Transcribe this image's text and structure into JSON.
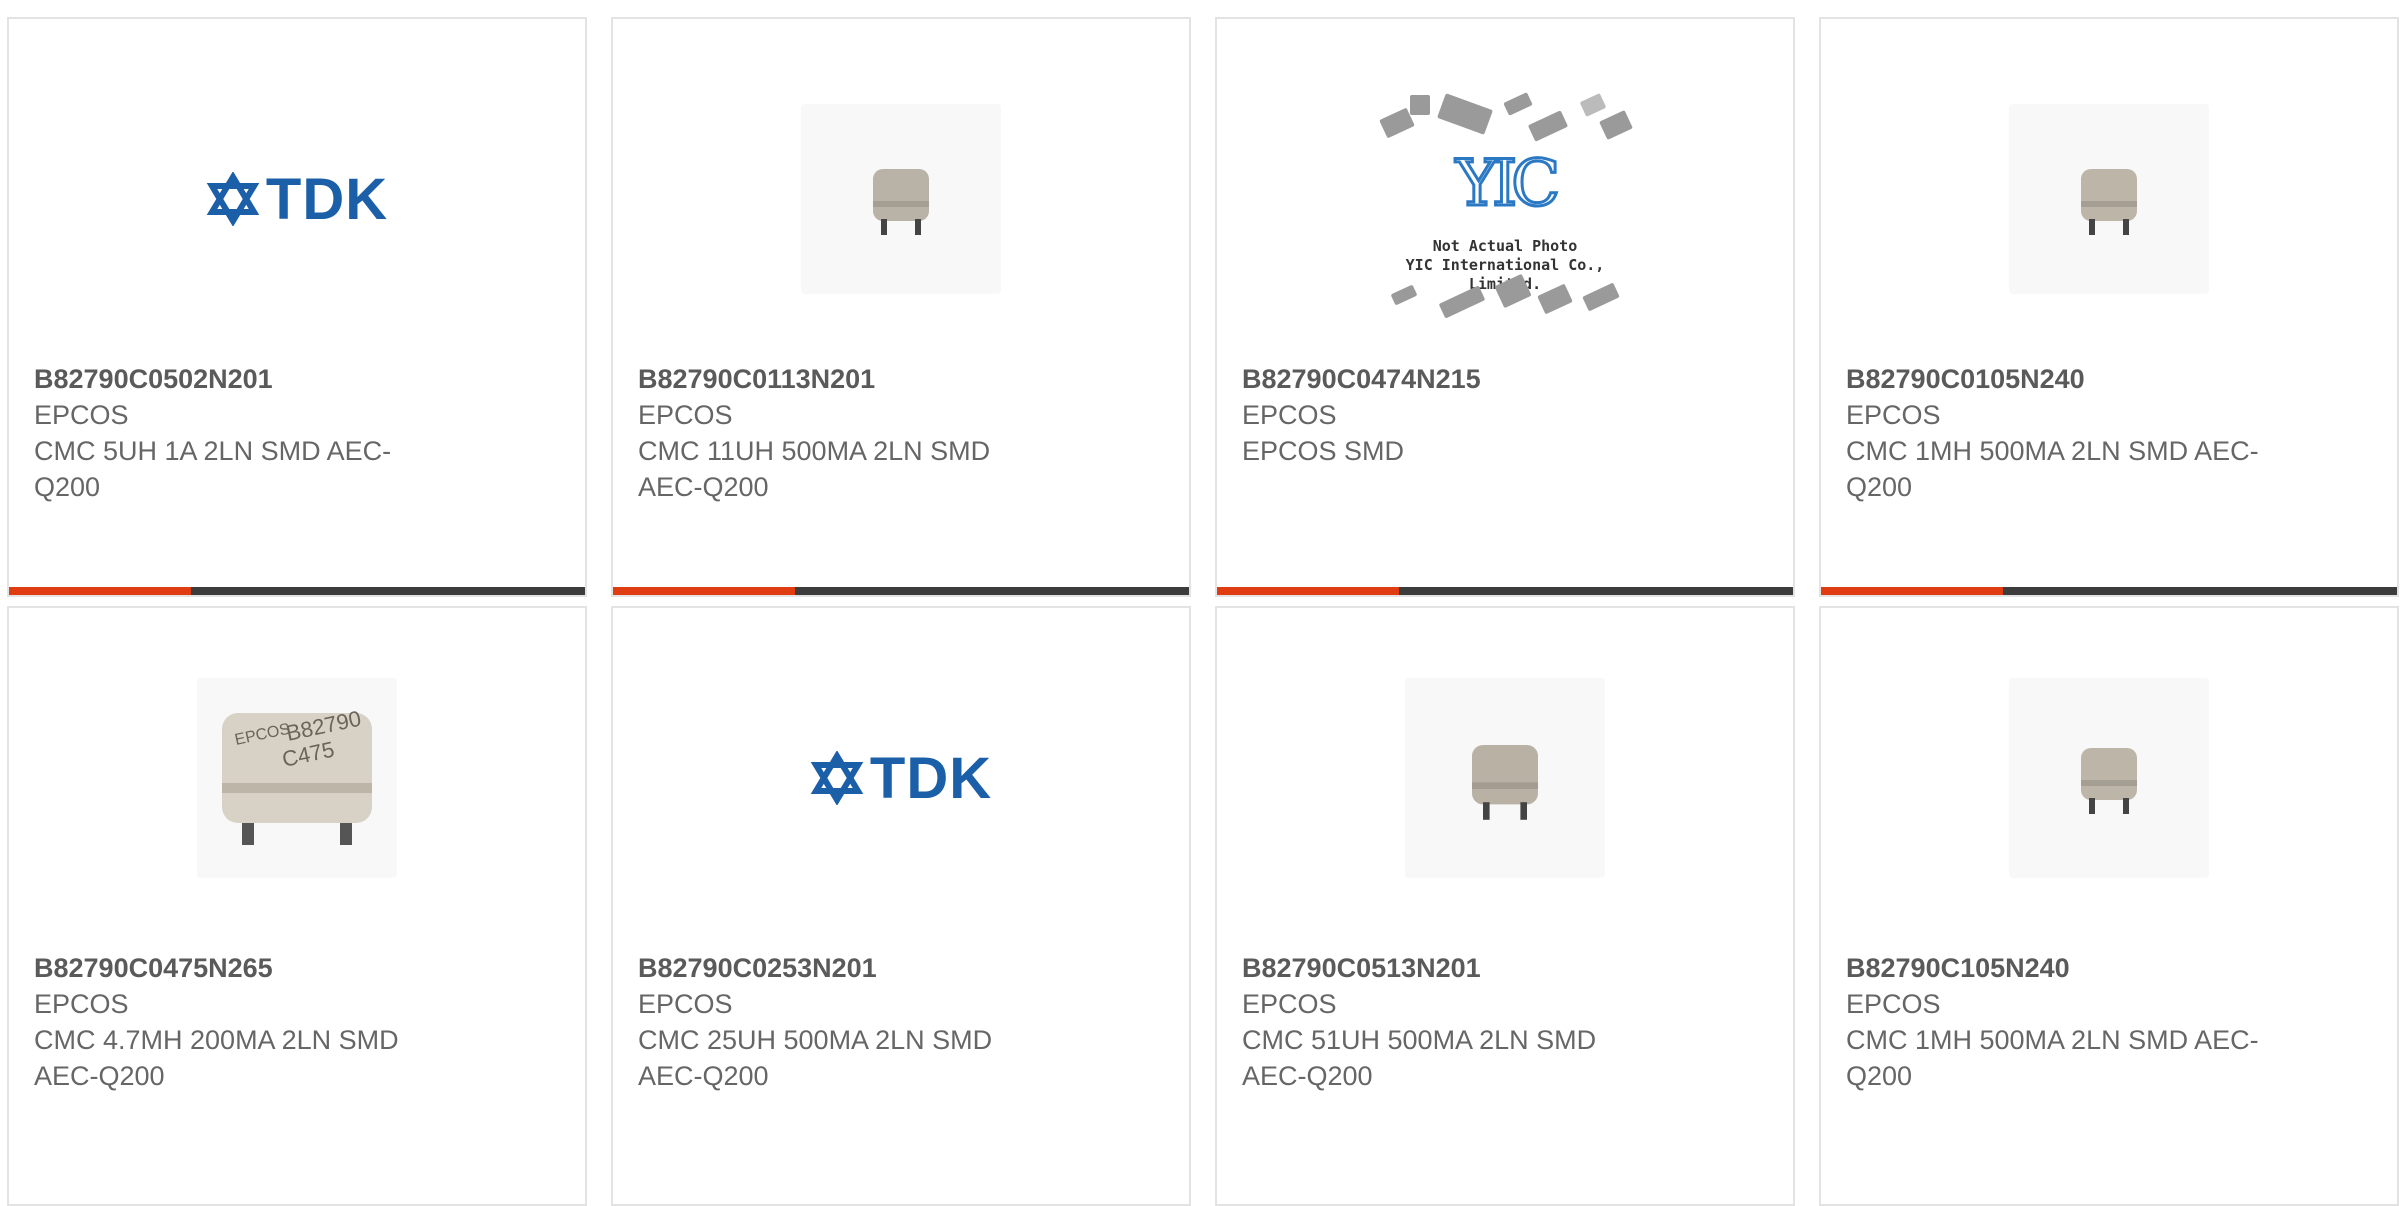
{
  "products": [
    {
      "part": "B82790C0502N201",
      "brand": "EPCOS",
      "desc": "CMC 5UH 1A 2LN SMD AEC-Q200",
      "image": "tdk-logo",
      "logo_text": "TDK"
    },
    {
      "part": "B82790C0113N201",
      "brand": "EPCOS",
      "desc": "CMC 11UH 500MA 2LN SMD AEC-Q200",
      "image": "component-photo"
    },
    {
      "part": "B82790C0474N215",
      "brand": "EPCOS",
      "desc": "EPCOS SMD",
      "image": "not-actual-photo",
      "logo_text": "YIC",
      "caption1": "Not Actual Photo",
      "caption2": "YIC International Co., Limited."
    },
    {
      "part": "B82790C0105N240",
      "brand": "EPCOS",
      "desc": "CMC 1MH 500MA 2LN SMD AEC-Q200",
      "image": "component-photo"
    },
    {
      "part": "B82790C0475N265",
      "brand": "EPCOS",
      "desc": "CMC 4.7MH 200MA 2LN SMD AEC-Q200",
      "image": "component-photo-large",
      "marking1": "EPCOS",
      "marking2": "B82790",
      "marking3": "C475"
    },
    {
      "part": "B82790C0253N201",
      "brand": "EPCOS",
      "desc": "CMC 25UH 500MA 2LN SMD AEC-Q200",
      "image": "tdk-logo",
      "logo_text": "TDK"
    },
    {
      "part": "B82790C0513N201",
      "brand": "EPCOS",
      "desc": "CMC 51UH 500MA 2LN SMD AEC-Q200",
      "image": "component-photo"
    },
    {
      "part": "B82790C105N240",
      "brand": "EPCOS",
      "desc": "CMC 1MH 500MA 2LN SMD AEC-Q200",
      "image": "component-photo"
    }
  ],
  "colors": {
    "accent": "#e03c12",
    "bar": "#3c3c3c",
    "tdk_blue": "#1b5fa9",
    "border": "#e3e3e3"
  }
}
